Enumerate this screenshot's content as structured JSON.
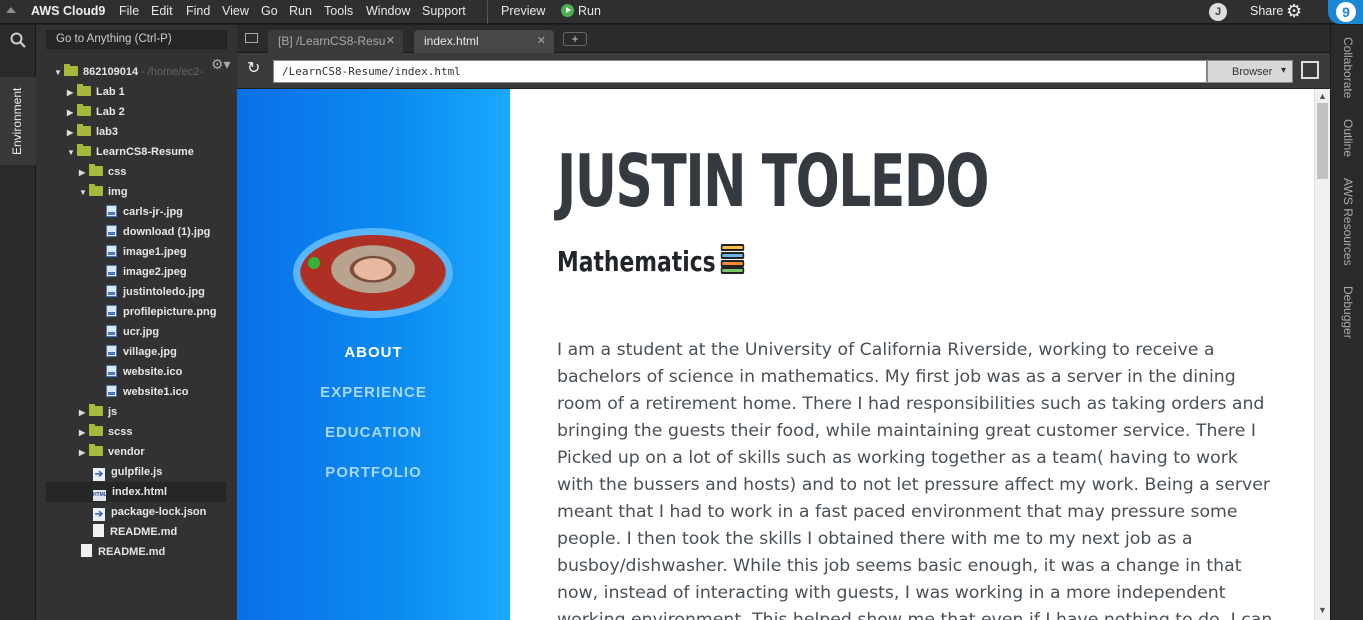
{
  "menubar": {
    "brand": "AWS Cloud9",
    "items": [
      "File",
      "Edit",
      "Find",
      "View",
      "Go",
      "Run",
      "Tools",
      "Window",
      "Support"
    ],
    "preview": "Preview",
    "run": "Run",
    "user_initial": "J",
    "share": "Share"
  },
  "sidebar": {
    "env_tab": "Environment",
    "goto_placeholder": "Go to Anything (Ctrl-P)"
  },
  "tree": {
    "root": "862109014",
    "root_path": " - /home/ec2-",
    "lab1": "Lab 1",
    "lab2": "Lab 2",
    "lab3": "lab3",
    "project": "LearnCS8-Resume",
    "css": "css",
    "img": "img",
    "images": [
      "carls-jr-.jpg",
      "download (1).jpg",
      "image1.jpeg",
      "image2.jpeg",
      "justintoledo.jpg",
      "profilepicture.png",
      "ucr.jpg",
      "village.jpg",
      "website.ico",
      "website1.ico"
    ],
    "js": "js",
    "scss": "scss",
    "vendor": "vendor",
    "gulpfile": "gulpfile.js",
    "index": "index.html",
    "package_lock": "package-lock.json",
    "readme_inner": "README.md",
    "readme_root": "README.md"
  },
  "tabs": {
    "tab1": "[B] /LearnCS8-Resu",
    "tab2": "index.html"
  },
  "browser": {
    "url": "/LearnCS8-Resume/index.html",
    "mode": "Browser"
  },
  "page": {
    "nav": [
      "ABOUT",
      "EXPERIENCE",
      "EDUCATION",
      "PORTFOLIO"
    ],
    "name": "JUSTIN TOLEDO",
    "subject": "Mathematics",
    "about": "I am a student at the University of California Riverside, working to receive a bachelors of science in mathematics. My first job was as a server in the dining room of a retirement home. There I had responsibilities such as taking orders and bringing the guests their food, while maintaining great customer service. There I Picked up on a lot of skills such as working together as a team( having to work with the bussers and hosts) and to not let pressure affect my work. Being a server meant that I had to work in a fast paced environment that may pressure some people. I then took the skills I obtained there with me to my next job as a busboy/dishwasher. While this job seems basic enough, it was a change in that now, instead of interacting with guests, I was working in a more independent working environment. This helped show me that even if I have nothing to do, I can"
  },
  "righttabs": [
    "Collaborate",
    "Outline",
    "AWS Resources",
    "Debugger"
  ],
  "colors": {
    "accent": "#1b88d6",
    "sidebar_nav_active": "#ffffff",
    "sidebar_nav_inactive": "#a9d8ff",
    "folder": "#a7b83a"
  }
}
